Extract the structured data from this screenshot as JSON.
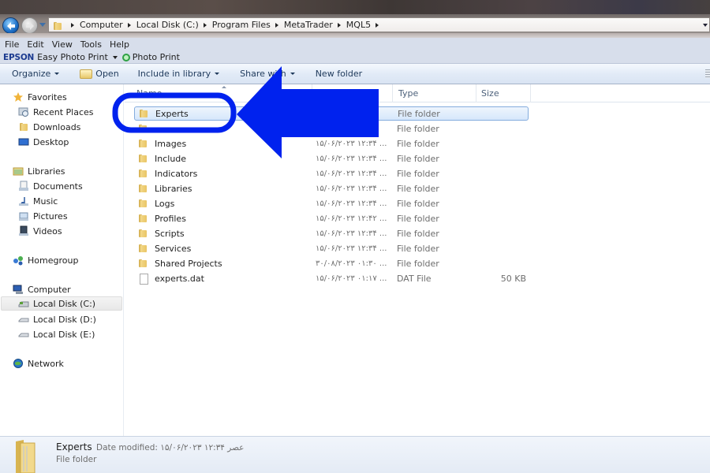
{
  "window": {
    "breadcrumb": [
      "Computer",
      "Local Disk (C:)",
      "Program Files",
      "MetaTrader",
      "MQL5"
    ]
  },
  "menubar": {
    "items": [
      "File",
      "Edit",
      "View",
      "Tools",
      "Help"
    ]
  },
  "epson_toolbar": {
    "brand": "EPSON",
    "easy_photo_print": "Easy Photo Print",
    "photo_print": "Photo Print"
  },
  "commandbar": {
    "organize": "Organize",
    "open": "Open",
    "include_in_library": "Include in library",
    "share_with": "Share with",
    "new_folder": "New folder"
  },
  "navpane": {
    "favorites": {
      "label": "Favorites",
      "items": [
        "Recent Places",
        "Downloads",
        "Desktop"
      ]
    },
    "libraries": {
      "label": "Libraries",
      "items": [
        "Documents",
        "Music",
        "Pictures",
        "Videos"
      ]
    },
    "homegroup": "Homegroup",
    "computer": {
      "label": "Computer",
      "items": [
        "Local Disk (C:)",
        "Local Disk (D:)",
        "Local Disk (E:)"
      ],
      "selected": "Local Disk (C:)"
    },
    "network": "Network"
  },
  "filelist": {
    "columns": {
      "name": "Name",
      "type": "Type",
      "size": "Size"
    },
    "rows": [
      {
        "name": "Experts",
        "date": "",
        "type": "File folder",
        "size": "",
        "selected": true
      },
      {
        "name": "",
        "date": "",
        "type": "File folder",
        "size": ""
      },
      {
        "name": "Images",
        "date": "۱۵/۰۶/۲۰۲۳ ۱۲:۳۴ ...",
        "type": "File folder",
        "size": ""
      },
      {
        "name": "Include",
        "date": "۱۵/۰۶/۲۰۲۳ ۱۲:۳۴ ...",
        "type": "File folder",
        "size": ""
      },
      {
        "name": "Indicators",
        "date": "۱۵/۰۶/۲۰۲۳ ۱۲:۳۴ ...",
        "type": "File folder",
        "size": ""
      },
      {
        "name": "Libraries",
        "date": "۱۵/۰۶/۲۰۲۳ ۱۲:۳۴ ...",
        "type": "File folder",
        "size": ""
      },
      {
        "name": "Logs",
        "date": "۱۵/۰۶/۲۰۲۳ ۱۲:۳۴ ...",
        "type": "File folder",
        "size": ""
      },
      {
        "name": "Profiles",
        "date": "۱۵/۰۶/۲۰۲۳ ۱۲:۴۲ ...",
        "type": "File folder",
        "size": ""
      },
      {
        "name": "Scripts",
        "date": "۱۵/۰۶/۲۰۲۳ ۱۲:۳۴ ...",
        "type": "File folder",
        "size": ""
      },
      {
        "name": "Services",
        "date": "۱۵/۰۶/۲۰۲۳ ۱۲:۳۴ ...",
        "type": "File folder",
        "size": ""
      },
      {
        "name": "Shared Projects",
        "date": "۳۰/۰۸/۲۰۲۳ ۰۱:۳۰ ...",
        "type": "File folder",
        "size": ""
      },
      {
        "name": "experts.dat",
        "date": "۱۵/۰۶/۲۰۲۳ ۰۱:۱۷ ...",
        "type": "DAT File",
        "size": "50 KB"
      }
    ]
  },
  "details": {
    "name": "Experts",
    "modified_label": "Date modified: ۱۵/۰۶/۲۰۲۳ عصر ۱۲:۳۴",
    "type": "File folder"
  },
  "annotation": {
    "color": "#0022ee",
    "target": "Experts"
  }
}
